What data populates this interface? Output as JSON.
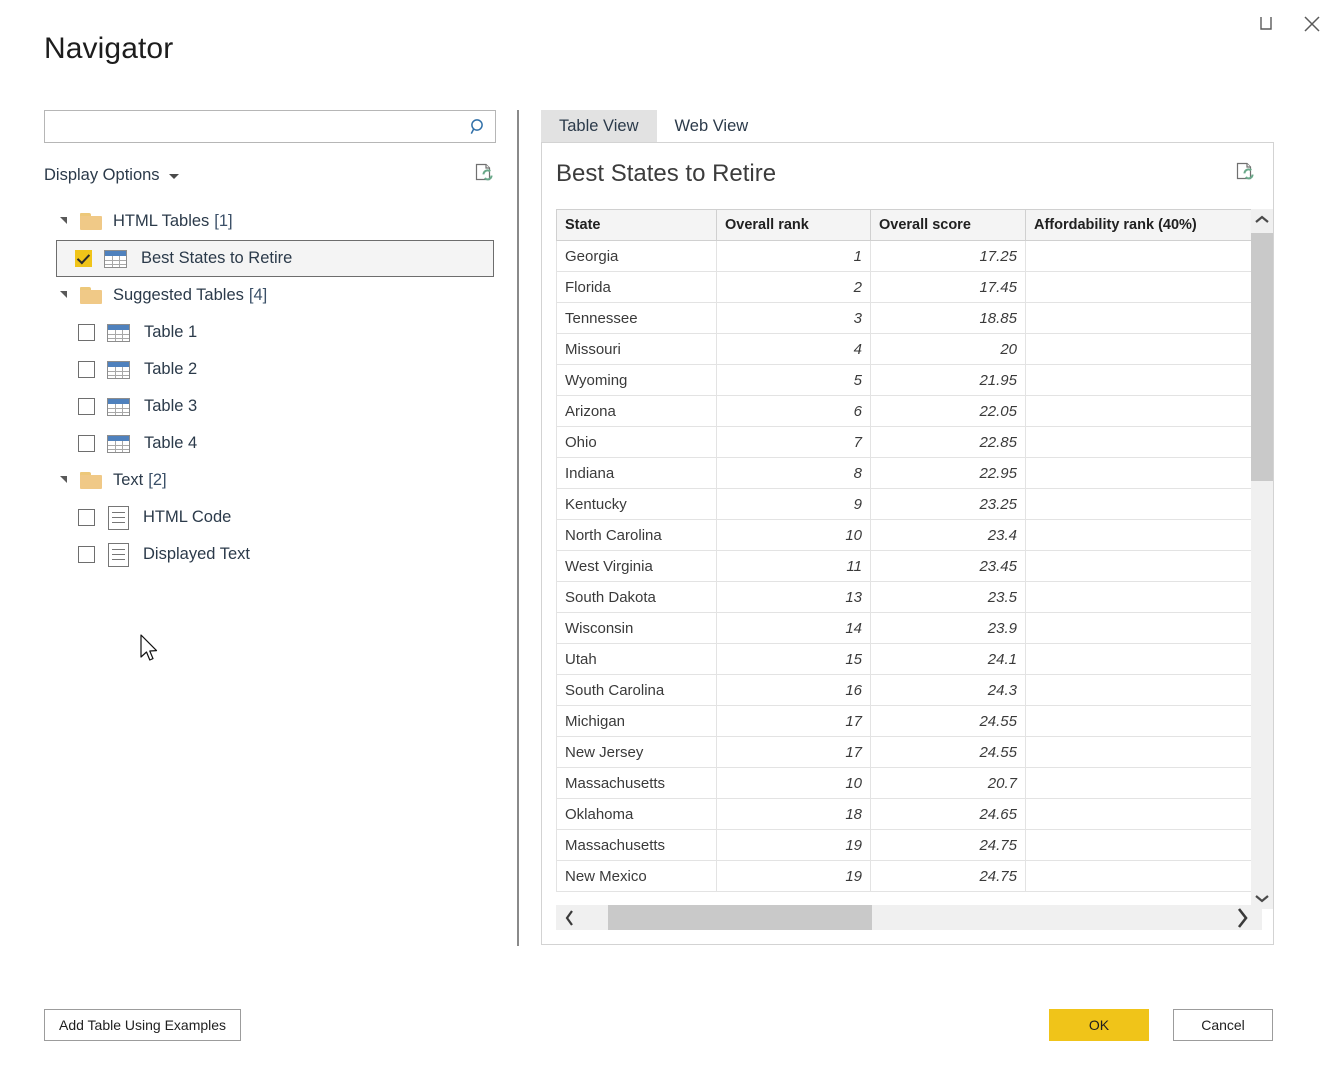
{
  "window": {
    "title": "Navigator",
    "controls": [
      {
        "name": "maximize-button",
        "icon": "maximize-icon"
      },
      {
        "name": "close-button",
        "icon": "close-icon"
      }
    ]
  },
  "search": {
    "value": "",
    "placeholder": "",
    "icon": "search-icon"
  },
  "display_options": {
    "label": "Display Options",
    "caret_icon": "chevron-down-icon",
    "refresh_icon": "refresh-page-icon"
  },
  "tree": {
    "groups": [
      {
        "label": "HTML Tables",
        "count": "[1]",
        "expanded": true,
        "icon": "folder-icon",
        "items": [
          {
            "label": "Best States to Retire",
            "checked": true,
            "selected": true,
            "icon": "table-icon"
          }
        ]
      },
      {
        "label": "Suggested Tables",
        "count": "[4]",
        "expanded": true,
        "icon": "folder-icon",
        "items": [
          {
            "label": "Table 1",
            "checked": false,
            "selected": false,
            "icon": "table-icon"
          },
          {
            "label": "Table 2",
            "checked": false,
            "selected": false,
            "icon": "table-icon"
          },
          {
            "label": "Table 3",
            "checked": false,
            "selected": false,
            "icon": "table-icon"
          },
          {
            "label": "Table 4",
            "checked": false,
            "selected": false,
            "icon": "table-icon"
          }
        ]
      },
      {
        "label": "Text",
        "count": "[2]",
        "expanded": true,
        "icon": "folder-icon",
        "items": [
          {
            "label": "HTML Code",
            "checked": false,
            "selected": false,
            "icon": "document-icon"
          },
          {
            "label": "Displayed Text",
            "checked": false,
            "selected": false,
            "icon": "document-icon"
          }
        ]
      }
    ]
  },
  "preview": {
    "tabs": [
      {
        "label": "Table View",
        "active": true
      },
      {
        "label": "Web View",
        "active": false
      }
    ],
    "title": "Best States to Retire",
    "refresh_icon": "refresh-page-icon",
    "scroll": {
      "vertical_up_icon": "chevron-up-icon",
      "vertical_down_icon": "chevron-down-icon",
      "horizontal_left_icon": "chevron-left-icon",
      "horizontal_right_icon": "chevron-right-icon"
    }
  },
  "chart_data": {
    "type": "table",
    "title": "Best States to Retire",
    "columns": [
      "State",
      "Overall rank",
      "Overall score",
      "Affordability rank (40%)"
    ],
    "rows": [
      [
        "Georgia",
        "1",
        "17.25",
        ""
      ],
      [
        "Florida",
        "2",
        "17.45",
        ""
      ],
      [
        "Tennessee",
        "3",
        "18.85",
        ""
      ],
      [
        "Missouri",
        "4",
        "20",
        ""
      ],
      [
        "Wyoming",
        "5",
        "21.95",
        ""
      ],
      [
        "Arizona",
        "6",
        "22.05",
        ""
      ],
      [
        "Ohio",
        "7",
        "22.85",
        ""
      ],
      [
        "Indiana",
        "8",
        "22.95",
        ""
      ],
      [
        "Kentucky",
        "9",
        "23.25",
        ""
      ],
      [
        "North Carolina",
        "10",
        "23.4",
        ""
      ],
      [
        "West Virginia",
        "11",
        "23.45",
        ""
      ],
      [
        "South Dakota",
        "13",
        "23.5",
        ""
      ],
      [
        "Wisconsin",
        "14",
        "23.9",
        ""
      ],
      [
        "Utah",
        "15",
        "24.1",
        ""
      ],
      [
        "South Carolina",
        "16",
        "24.3",
        ""
      ],
      [
        "Michigan",
        "17",
        "24.55",
        ""
      ],
      [
        "New Jersey",
        "17",
        "24.55",
        ""
      ],
      [
        "Massachusetts",
        "10",
        "20.7",
        ""
      ],
      [
        "Oklahoma",
        "18",
        "24.65",
        ""
      ],
      [
        "Massachusetts",
        "19",
        "24.75",
        ""
      ],
      [
        "New Mexico",
        "19",
        "24.75",
        ""
      ]
    ]
  },
  "footer": {
    "add_table_label": "Add Table Using Examples",
    "ok_label": "OK",
    "cancel_label": "Cancel"
  },
  "colors": {
    "accent_yellow": "#f0c419",
    "folder": "#f0c987",
    "table_header_blue": "#4f81bd",
    "refresh_green": "#6aa98a",
    "search_blue": "#2f6fa8"
  }
}
